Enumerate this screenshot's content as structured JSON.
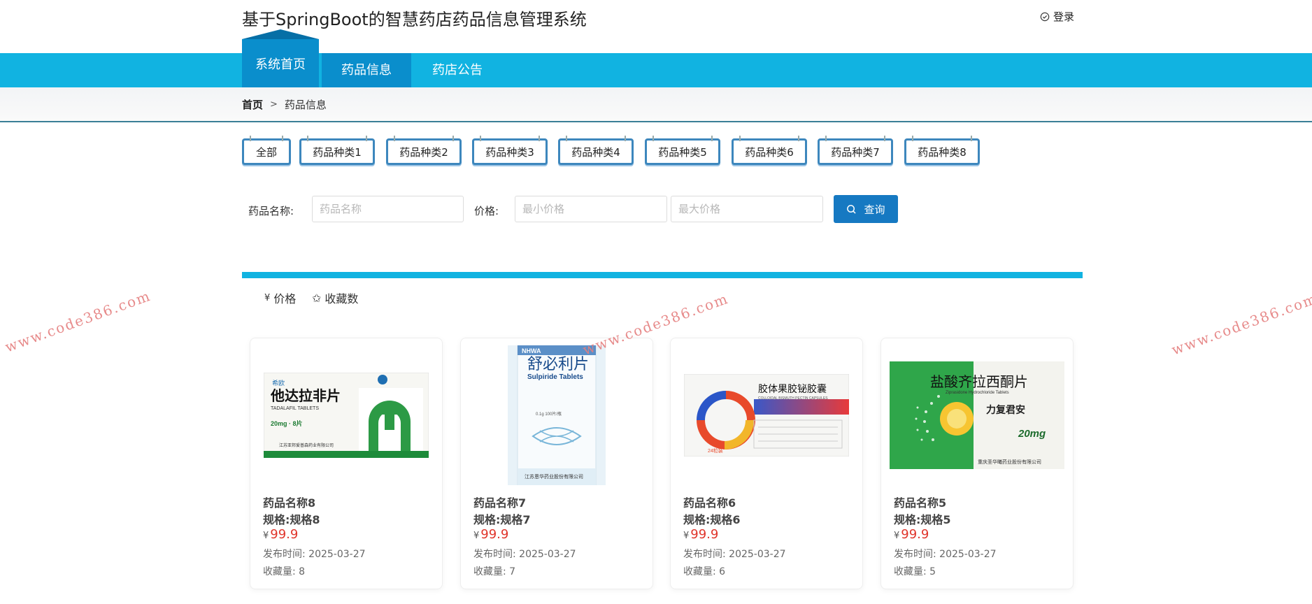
{
  "header": {
    "title": "基于SpringBoot的智慧药店药品信息管理系统",
    "login": "登录"
  },
  "nav": {
    "home": "系统首页",
    "drug": "药品信息",
    "notice": "药店公告"
  },
  "breadcrumb": {
    "home": "首页",
    "sep": ">",
    "current": "药品信息"
  },
  "categories": [
    "全部",
    "药品种类1",
    "药品种类2",
    "药品种类3",
    "药品种类4",
    "药品种类5",
    "药品种类6",
    "药品种类7",
    "药品种类8"
  ],
  "search": {
    "name_label": "药品名称:",
    "name_placeholder": "药品名称",
    "price_label": "价格:",
    "min_placeholder": "最小价格",
    "max_placeholder": "最大价格",
    "button": "查询"
  },
  "sort": {
    "price": "价格",
    "price_icon": "¥",
    "fav": "收藏数",
    "fav_icon": "✩"
  },
  "watermark": "www.code386.com",
  "colors": {
    "nav": "#11b3e1",
    "nav_active": "#0a8ecc",
    "button": "#1679c2",
    "price": "#e0352b"
  },
  "products": [
    {
      "name": "药品名称8",
      "spec": "规格:规格8",
      "currency": "¥",
      "price": "99.9",
      "date": "发布时间:  2025-03-27",
      "fav": "收藏量:  8",
      "pack": {
        "title": "他达拉非片",
        "sub": "TADALAFIL TABLETS",
        "dose": "20mg · 8片",
        "brand": "希欧",
        "foot": "江苏亚邦爱普森药业有限公司"
      }
    },
    {
      "name": "药品名称7",
      "spec": "规格:规格7",
      "currency": "¥",
      "price": "99.9",
      "date": "发布时间:  2025-03-27",
      "fav": "收藏量:  7",
      "pack": {
        "title": "舒必利片",
        "sub": "Sulpiride Tablets",
        "dose": "0.1g 100片/瓶",
        "brand": "NHWA",
        "foot": "江苏恩华药业股份有限公司"
      }
    },
    {
      "name": "药品名称6",
      "spec": "规格:规格6",
      "currency": "¥",
      "price": "99.9",
      "date": "发布时间:  2025-03-27",
      "fav": "收藏量:  6",
      "pack": {
        "title": "胶体果胶铋胶囊",
        "sub": "COLLOIDAL BISMUTH PECTIN CAPSULES",
        "dose": "24粒装",
        "brand": "",
        "foot": ""
      }
    },
    {
      "name": "药品名称5",
      "spec": "规格:规格5",
      "currency": "¥",
      "price": "99.9",
      "date": "发布时间:  2025-03-27",
      "fav": "收藏量:  5",
      "pack": {
        "title": "盐酸齐拉西酮片",
        "sub": "Ziprasidone Hydrochloride Tablets",
        "dose": "20mg",
        "brand": "力复君安",
        "foot": "重庆圣华曦药业股份有限公司"
      }
    }
  ]
}
